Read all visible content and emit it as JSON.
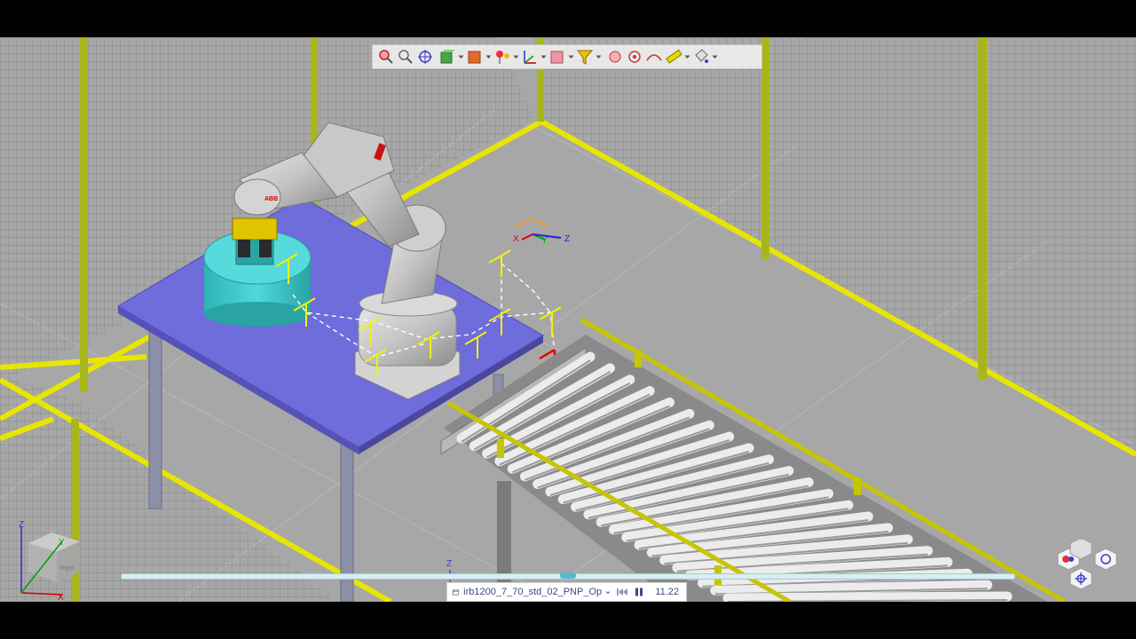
{
  "toolbar": {
    "buttons": [
      {
        "name": "zoom-window-icon",
        "dropdown": false
      },
      {
        "name": "zoom-fit-icon",
        "dropdown": false
      },
      {
        "name": "pan-target-icon",
        "dropdown": false
      },
      {
        "name": "view-box-icon",
        "dropdown": true
      },
      {
        "name": "shaded-box-icon",
        "dropdown": true
      },
      {
        "name": "pin-light-icon",
        "dropdown": true
      },
      {
        "name": "frame-axis-icon",
        "dropdown": true
      },
      {
        "name": "transparent-cube-icon",
        "dropdown": true
      },
      {
        "name": "select-filter-icon",
        "dropdown": true
      },
      {
        "name": "snap-object-icon",
        "dropdown": false
      },
      {
        "name": "snap-center-icon",
        "dropdown": false
      },
      {
        "name": "snap-edge-icon",
        "dropdown": false
      },
      {
        "name": "measure-ruler-icon",
        "dropdown": true
      },
      {
        "name": "paint-bucket-icon",
        "dropdown": true
      }
    ]
  },
  "playbar": {
    "procedure": "irb1200_7_70_std_02_PNP_Op",
    "dropdown_icon": "chevron-down-icon",
    "rewind_icon": "rewind-icon",
    "pause_icon": "pause-icon",
    "time": "11.22"
  },
  "timeline": {
    "progress": 0.5
  },
  "scene": {
    "robot_brand": "ABB",
    "frame_label_x": "X",
    "frame_label_y": "Y",
    "frame_label_z": "Z",
    "world_axis_label": "Z"
  },
  "navcube": {
    "axis_x": "X",
    "axis_y": "Y",
    "axis_z": "Z",
    "face_label": "Right"
  },
  "colors": {
    "floor": "#a7a7a7",
    "fence_post": "#a8b61b",
    "rail_yellow": "#e6e600",
    "table_top": "#6f6cdc",
    "cylinder": "#37c7c8",
    "robot": "#c7c7c7",
    "target_yellow": "#f2f200",
    "accent": "#3b4a87"
  }
}
